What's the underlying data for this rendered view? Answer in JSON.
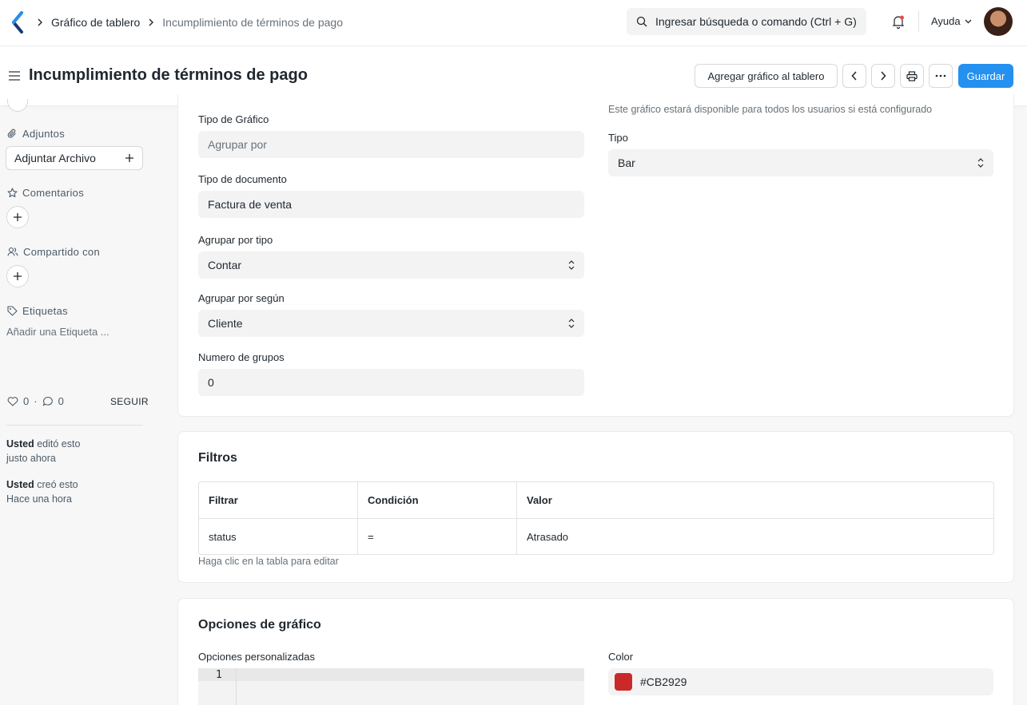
{
  "navbar": {
    "breadcrumbs": [
      "Gráfico de tablero",
      "Incumplimiento de términos de pago"
    ],
    "search_placeholder": "Ingresar búsqueda o comando (Ctrl + G)",
    "help_label": "Ayuda"
  },
  "header": {
    "title": "Incumplimiento de términos de pago",
    "add_to_dashboard_label": "Agregar gráfico al tablero",
    "save_label": "Guardar"
  },
  "sidebar": {
    "attachments_label": "Adjuntos",
    "attach_file_label": "Adjuntar Archivo",
    "comments_label": "Comentarios",
    "shared_with_label": "Compartido con",
    "tags_label": "Etiquetas",
    "add_tag_label": "Añadir una Etiqueta ...",
    "likes_count": "0",
    "comments_count": "0",
    "follow_label": "SEGUIR",
    "activity": [
      {
        "user": "Usted",
        "action": "editó esto",
        "time": "justo ahora"
      },
      {
        "user": "Usted",
        "action": "creó esto",
        "time": "Hace una hora"
      }
    ]
  },
  "form": {
    "chart_type_label": "Tipo de Gráfico",
    "chart_type_value": "Agrupar por",
    "doctype_label": "Tipo de documento",
    "doctype_value": "Factura de venta",
    "group_by_type_label": "Agrupar por tipo",
    "group_by_type_value": "Contar",
    "group_by_based_on_label": "Agrupar por según",
    "group_by_based_on_value": "Cliente",
    "num_groups_label": "Numero de grupos",
    "num_groups_value": "0",
    "public_hint": "Este gráfico estará disponible para todos los usuarios si está configurado",
    "type_label": "Tipo",
    "type_value": "Bar"
  },
  "filters": {
    "title": "Filtros",
    "columns": [
      "Filtrar",
      "Condición",
      "Valor"
    ],
    "rows": [
      [
        "status",
        "=",
        "Atrasado"
      ]
    ],
    "hint": "Haga clic en la tabla para editar"
  },
  "chart_options": {
    "title": "Opciones de gráfico",
    "custom_options_label": "Opciones personalizadas",
    "line_number": "1",
    "color_label": "Color",
    "color_value": "#CB2929"
  },
  "colors": {
    "primary": "#2490ef",
    "swatch": "#CB2929"
  }
}
